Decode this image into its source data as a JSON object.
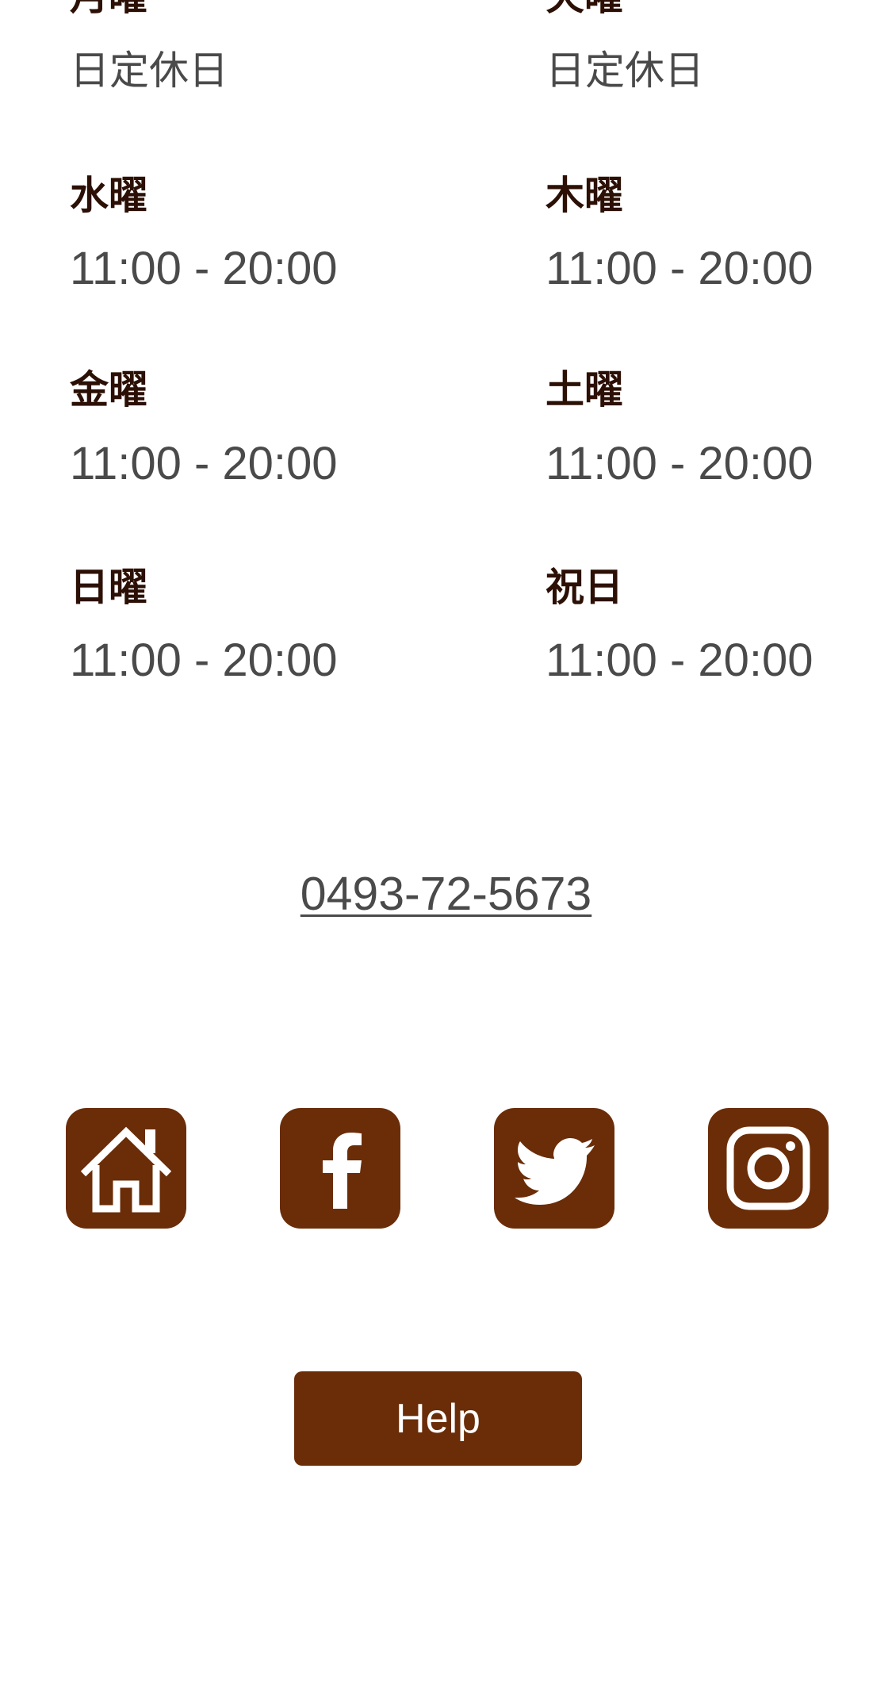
{
  "hours": {
    "mon": {
      "day": "月曜",
      "hours": "日定休日"
    },
    "tue": {
      "day": "火曜",
      "hours": "日定休日"
    },
    "wed": {
      "day": "水曜",
      "hours": "11:00 - 20:00"
    },
    "thu": {
      "day": "木曜",
      "hours": "11:00 - 20:00"
    },
    "fri": {
      "day": "金曜",
      "hours": "11:00 - 20:00"
    },
    "sat": {
      "day": "土曜",
      "hours": "11:00 - 20:00"
    },
    "sun": {
      "day": "日曜",
      "hours": "11:00 - 20:00"
    },
    "hol": {
      "day": "祝日",
      "hours": "11:00 - 20:00"
    }
  },
  "contact": {
    "phone": "0493-72-5673"
  },
  "social": {
    "items": [
      {
        "icon": "home-icon"
      },
      {
        "icon": "facebook-icon"
      },
      {
        "icon": "twitter-icon"
      },
      {
        "icon": "instagram-icon"
      }
    ],
    "accent_color": "#6a2d08"
  },
  "footer": {
    "help_label": "Help"
  }
}
